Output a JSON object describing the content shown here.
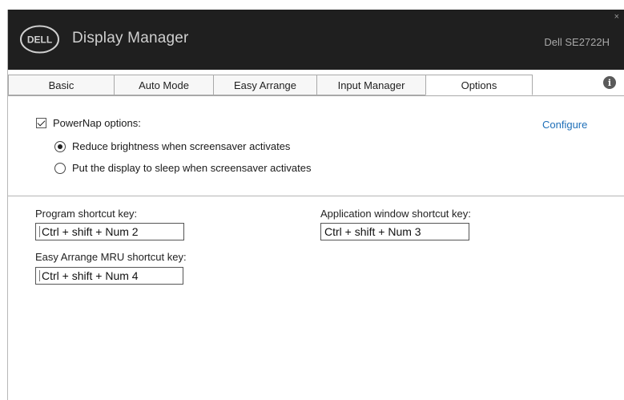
{
  "titlebar": {
    "logo_text": "DELL",
    "app_title": "Display Manager",
    "monitor_name": "Dell SE2722H",
    "close_glyph": "×"
  },
  "tabs": [
    {
      "label": "Basic",
      "active": false
    },
    {
      "label": "Auto Mode",
      "active": false
    },
    {
      "label": "Easy Arrange",
      "active": false
    },
    {
      "label": "Input Manager",
      "active": false
    },
    {
      "label": "Options",
      "active": true
    }
  ],
  "info_icon": "info-icon",
  "options": {
    "powernap_label": "PowerNap options:",
    "powernap_checked": true,
    "configure_link": "Configure",
    "radio_reduce": {
      "label": "Reduce brightness when screensaver activates",
      "selected": true
    },
    "radio_sleep": {
      "label": "Put the display to sleep when screensaver activates",
      "selected": false
    }
  },
  "shortcuts": {
    "program_label": "Program shortcut key:",
    "program_value": "Ctrl + shift + Num 2",
    "app_window_label": "Application window shortcut key:",
    "app_window_value": "Ctrl + shift + Num 3",
    "mru_label": "Easy Arrange MRU shortcut key:",
    "mru_value": "Ctrl + shift + Num 4"
  },
  "colors": {
    "titlebar_bg": "#1f1f1f",
    "link": "#1e6fb8"
  }
}
